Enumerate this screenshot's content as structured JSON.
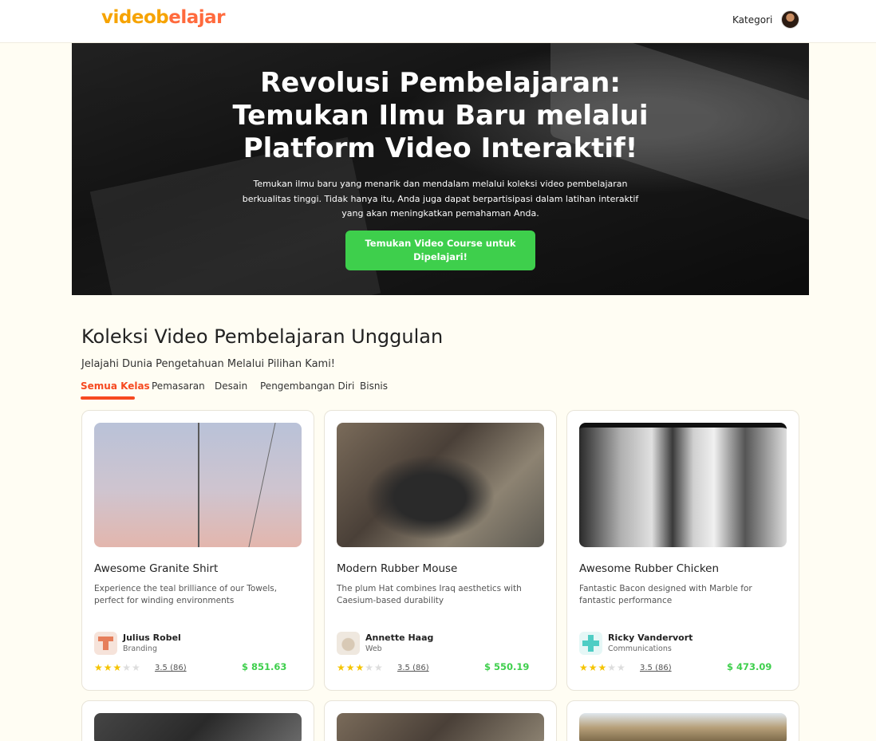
{
  "header": {
    "logo_part1": "videob",
    "logo_part2": "elajar",
    "nav_kategori": "Kategori"
  },
  "hero": {
    "title_line1": "Revolusi Pembelajaran:",
    "title_line2": "Temukan Ilmu Baru melalui",
    "title_line3": "Platform Video Interaktif!",
    "subtitle": "Temukan ilmu baru yang menarik dan mendalam melalui koleksi video pembelajaran berkualitas tinggi. Tidak hanya itu, Anda juga dapat berpartisipasi dalam latihan interaktif yang akan meningkatkan pemahaman Anda.",
    "cta_line1": "Temukan Video Course untuk",
    "cta_line2": "Dipelajari!"
  },
  "section": {
    "title": "Koleksi Video Pembelajaran Unggulan",
    "subtitle": "Jelajahi Dunia Pengetahuan Melalui Pilihan Kami!"
  },
  "tabs": [
    {
      "label": "Semua Kelas",
      "active": true
    },
    {
      "label": "Pemasaran",
      "active": false
    },
    {
      "label": "Desain",
      "active": false
    },
    {
      "label": "Pengembangan Diri",
      "active": false
    },
    {
      "label": "Bisnis",
      "active": false
    }
  ],
  "colors": {
    "accent": "#f64920",
    "cta": "#3ecf4c",
    "logo_yellow": "#f6a300",
    "logo_orange": "#ff6a3d",
    "background": "#fffdf3"
  },
  "cards": [
    {
      "title": "Awesome Granite Shirt",
      "description": "Experience the teal brilliance of our Towels, perfect for winding environments",
      "instructor": "Julius Robel",
      "role": "Branding",
      "stars": "★★★",
      "stars_off": "★★",
      "rating_value": 3.5,
      "rating": "3.5 (86)",
      "price": "$ 851.63"
    },
    {
      "title": "Modern Rubber Mouse",
      "description": "The plum Hat combines Iraq aesthetics with Caesium-based durability",
      "instructor": "Annette Haag",
      "role": "Web",
      "stars": "★★★",
      "stars_off": "★★",
      "rating_value": 3.5,
      "rating": "3.5 (86)",
      "price": "$ 550.19"
    },
    {
      "title": "Awesome Rubber Chicken",
      "description": "Fantastic Bacon designed with Marble for fantastic performance",
      "instructor": "Ricky Vandervort",
      "role": "Communications",
      "stars": "★★★",
      "stars_off": "★★",
      "rating_value": 3.5,
      "rating": "3.5 (86)",
      "price": "$ 473.09"
    }
  ]
}
